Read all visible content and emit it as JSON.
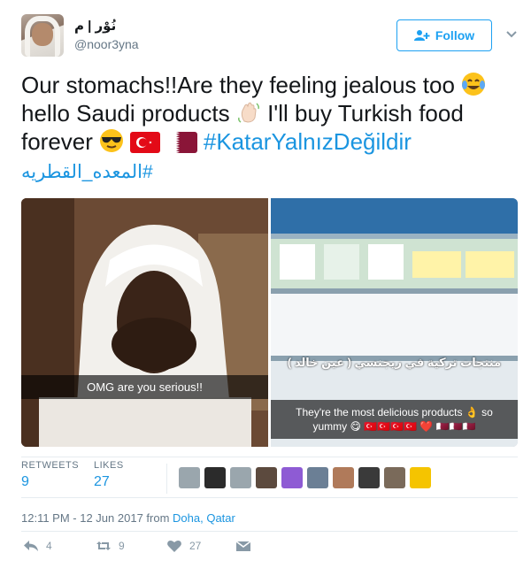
{
  "user": {
    "display_name": "نُوْر | م",
    "handle": "@noor3yna"
  },
  "follow": {
    "label": "Follow"
  },
  "tweet": {
    "text_part1": "Our stomachs!!Are they feeling jealous too ",
    "text_part2": " hello Saudi products ",
    "text_part3": " I'll buy Turkish food forever",
    "hashtag1": "#KatarYalnızDeğildir",
    "hashtag2": "#المعده_القطريه"
  },
  "media": {
    "left_caption": "OMG are you serious!!",
    "right_caption_ar": "منتجات تركية في ريجنسي ( عين خالد )",
    "right_caption_line1": "They're the most delicious products",
    "right_caption_so": "so",
    "right_caption_line2": "yummy"
  },
  "stats": {
    "retweets_label": "RETWEETS",
    "retweets_count": "9",
    "likes_label": "LIKES",
    "likes_count": "27"
  },
  "likers": {
    "colors": [
      "#9aa6ad",
      "#2b2b2b",
      "#9aa6ad",
      "#5c4a3e",
      "#8e5bd4",
      "#6b7f95",
      "#b07a5a",
      "#3a3a3a",
      "#7a6a5a",
      "#f5c400"
    ]
  },
  "timestamp": {
    "time": "12:11 PM - 12 Jun 2017 from ",
    "location": "Doha, Qatar"
  },
  "actions": {
    "reply_count": "4",
    "retweet_count": "9",
    "like_count": "27"
  },
  "colors": {
    "accent": "#1da1f2",
    "hashtag": "#1b95e0",
    "muted": "#657786"
  },
  "icons": {
    "follow": "person-plus-icon",
    "caret": "chevron-down-icon",
    "reply": "reply-icon",
    "retweet": "retweet-icon",
    "like": "heart-icon",
    "dm": "envelope-icon"
  }
}
